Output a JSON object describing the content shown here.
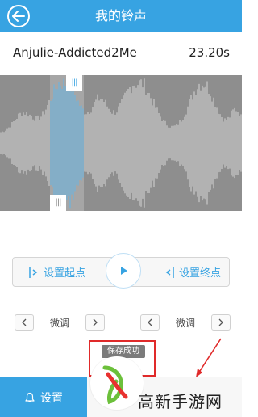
{
  "header": {
    "title": "我的铃声"
  },
  "song": {
    "name": "Anjulie-Addicted2Me",
    "duration": "23.20s"
  },
  "controls": {
    "set_start": "设置起点",
    "set_end": "设置终点"
  },
  "fine_tune": {
    "left_label": "微调",
    "right_label": "微调"
  },
  "toast": {
    "text": "保存成功"
  },
  "bottom": {
    "set_label": "设置"
  },
  "watermark": {
    "text": "高新手游网"
  },
  "colors": {
    "accent": "#37a3e2",
    "toast_border": "#e02a2a",
    "waveform_bg": "#8e8e8e"
  }
}
